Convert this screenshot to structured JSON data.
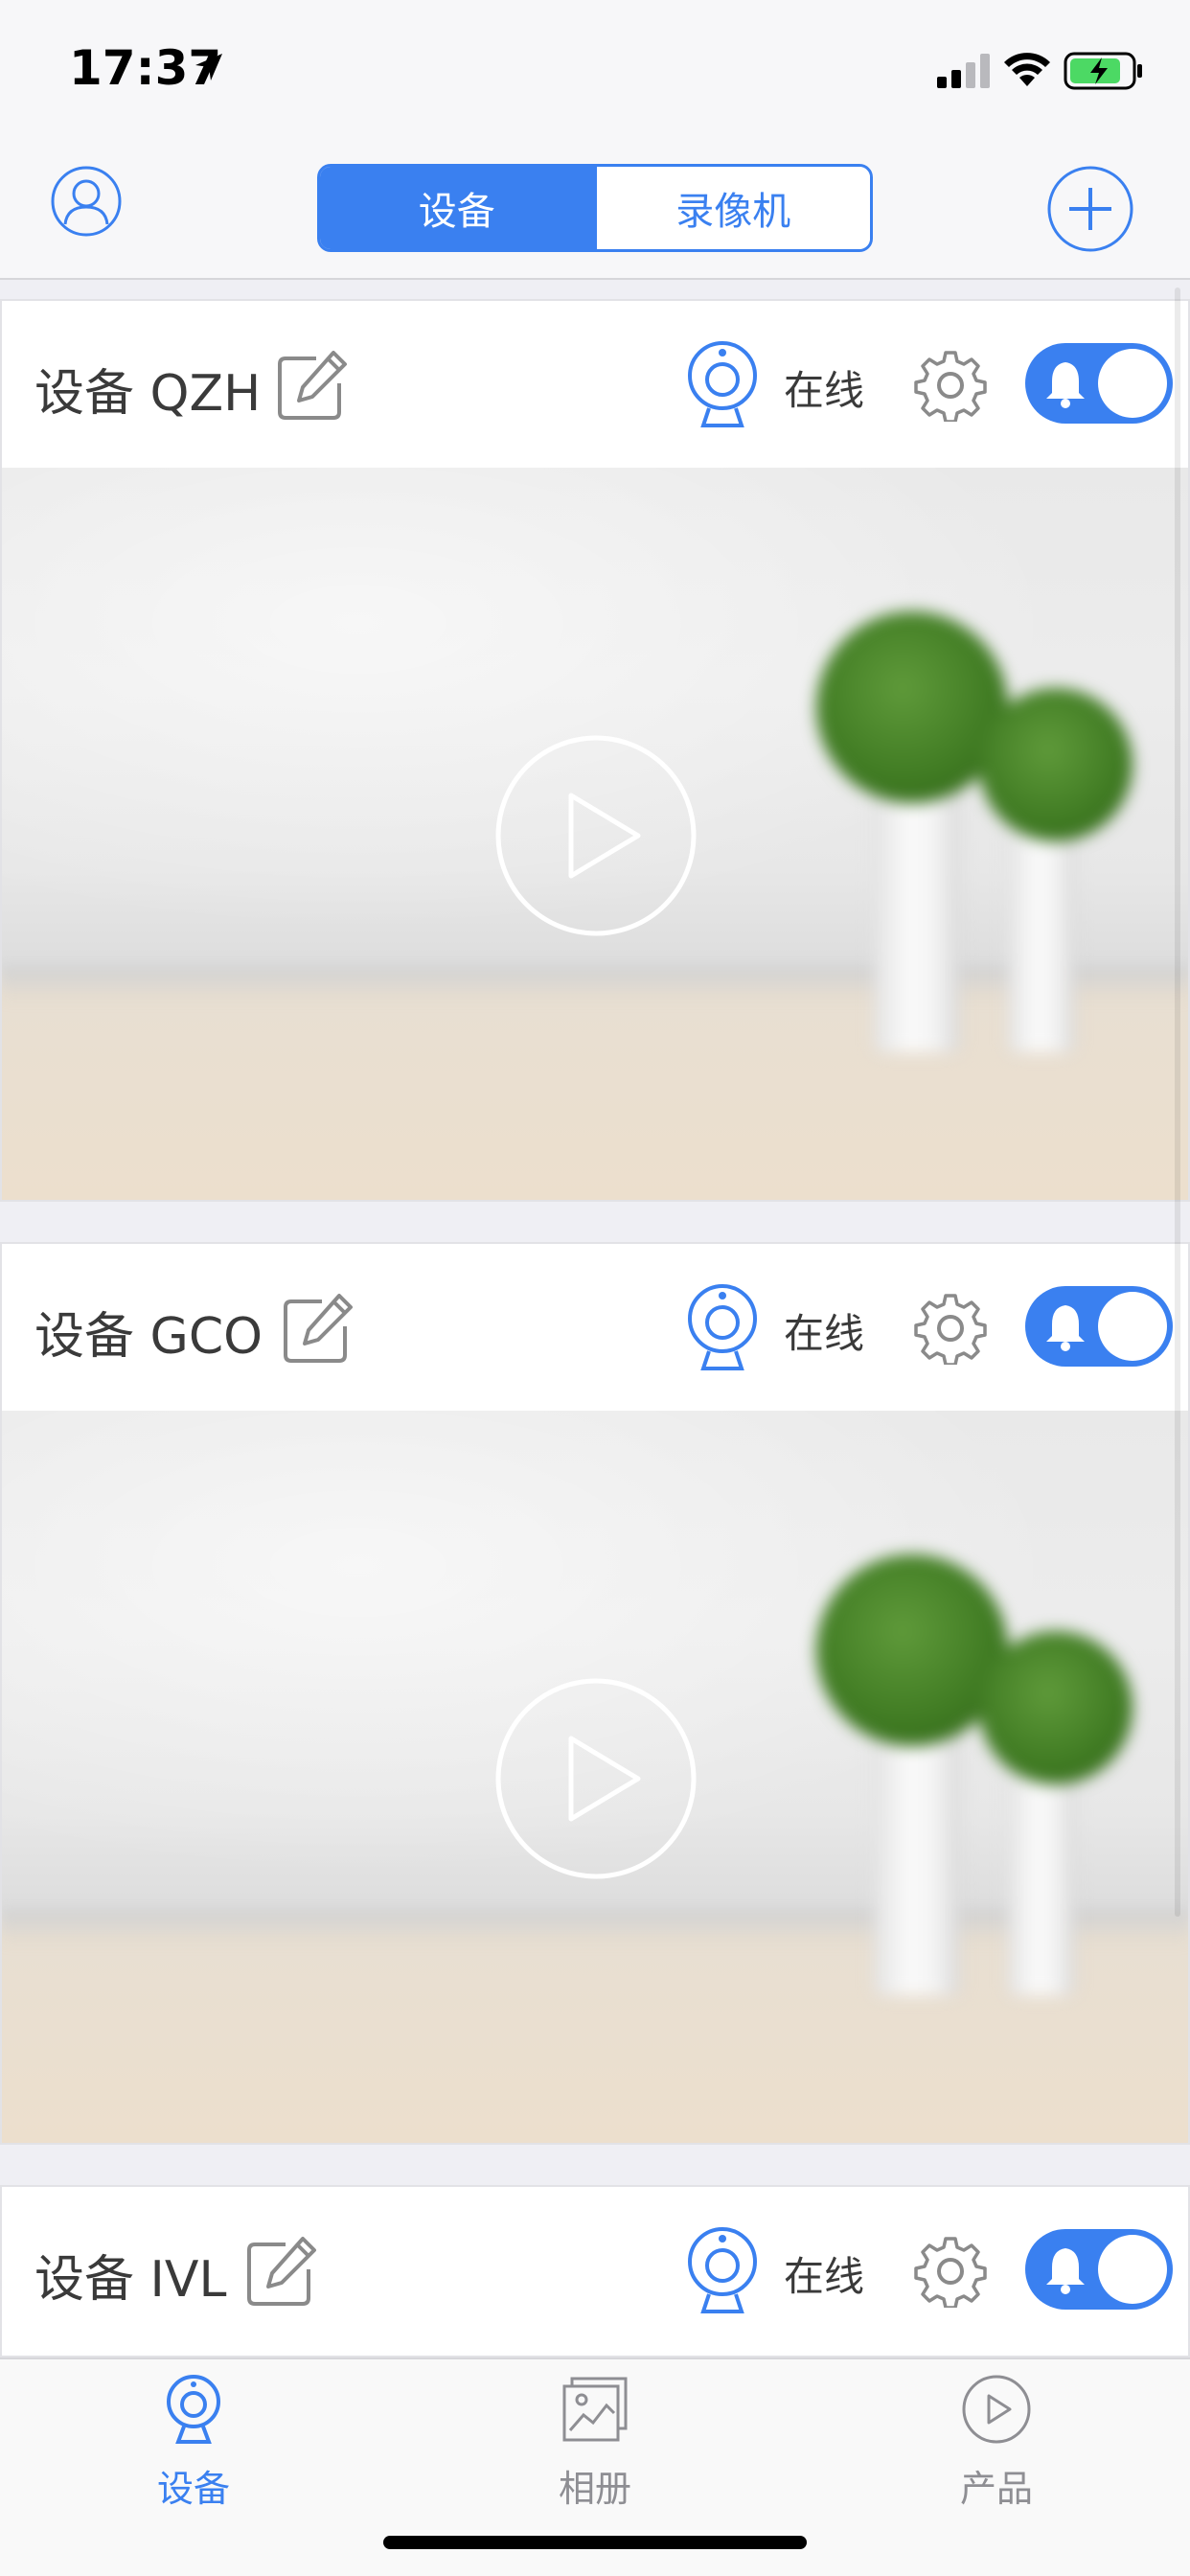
{
  "status_bar": {
    "time": "17:37"
  },
  "nav": {
    "segments": [
      {
        "label": "设备",
        "active": true
      },
      {
        "label": "录像机",
        "active": false
      }
    ],
    "accent_color": "#3a80f0"
  },
  "devices": [
    {
      "name": "设备 QZH",
      "status": "在线",
      "alert_enabled": true
    },
    {
      "name": "设备 GCO",
      "status": "在线",
      "alert_enabled": true
    },
    {
      "name": "设备 IVL",
      "status": "在线",
      "alert_enabled": true
    }
  ],
  "tabs": [
    {
      "label": "设备",
      "icon": "camera-icon",
      "active": true
    },
    {
      "label": "相册",
      "icon": "album-icon",
      "active": false
    },
    {
      "label": "产品",
      "icon": "play-circle-icon",
      "active": false
    }
  ]
}
